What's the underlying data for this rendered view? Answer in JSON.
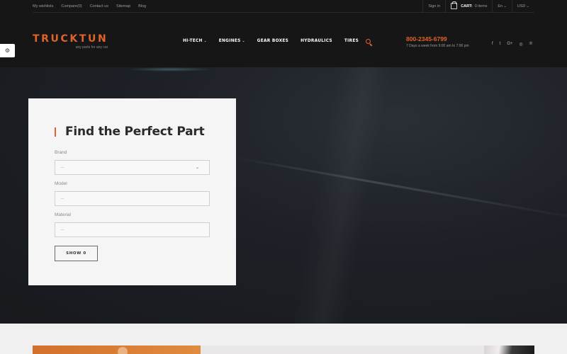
{
  "topbar": {
    "links": [
      "My wishlists",
      "Compare(0)",
      "Contact us",
      "Sitemap",
      "Blog"
    ],
    "sign_in": "Sign in",
    "cart_label": "CART:",
    "cart_count": "0 items",
    "language": "En",
    "currency": "USD"
  },
  "side_tab": {
    "icon": "gears-icon",
    "glyph": "⚙"
  },
  "logo": {
    "name": "TRUCKTUN",
    "tagline": "any parts for any car"
  },
  "nav": {
    "items": [
      {
        "label": "HI-TECH",
        "dropdown": true
      },
      {
        "label": "ENGINES",
        "dropdown": true
      },
      {
        "label": "GEAR BOXES",
        "dropdown": false
      },
      {
        "label": "HYDRAULICS",
        "dropdown": false
      },
      {
        "label": "TIRES",
        "dropdown": false
      }
    ],
    "dropdown_glyph": "⌄"
  },
  "contact": {
    "phone": "800-2345-6799",
    "hours": "7 Days a week from 9:00 am to 7:00 pm"
  },
  "social": [
    "f",
    "t",
    "G+",
    "◎",
    "℗"
  ],
  "finder": {
    "title": "Find the Perfect Part",
    "brand_label": "Brand",
    "brand_value": "--",
    "model_label": "Model",
    "model_value": "--",
    "material_label": "Material",
    "material_value": "--",
    "button_label": "SHOW 0"
  },
  "colors": {
    "accent": "#e0632a",
    "header_bg": "#161616",
    "panel_bg": "#f5f5f5"
  }
}
